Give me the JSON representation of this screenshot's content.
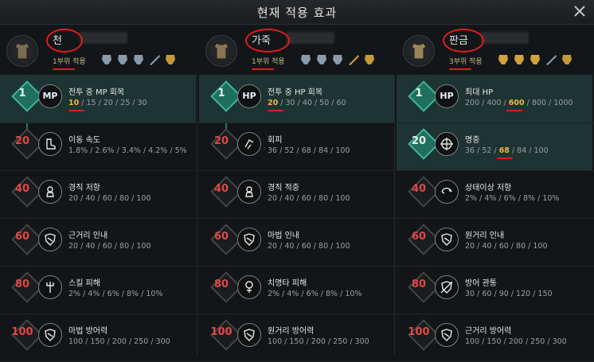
{
  "window": {
    "title": "현재 적용 효과"
  },
  "columns": [
    {
      "name": "천",
      "rank_label": "1부위 적용",
      "rows": [
        {
          "level": "1",
          "icon": "MP",
          "name": "전투 중 MP 회복",
          "values": [
            "10",
            "15",
            "20",
            "25",
            "30"
          ],
          "highlight": 0,
          "active": true
        },
        {
          "level": "20",
          "icon": "boot-icon",
          "name": "이동 속도",
          "values": [
            "1.8%",
            "2.6%",
            "3.4%",
            "4.2%",
            "5%"
          ],
          "highlight": -1,
          "active": false
        },
        {
          "level": "40",
          "icon": "stun-icon",
          "name": "경직 저항",
          "values": [
            "20",
            "40",
            "60",
            "80",
            "100"
          ],
          "highlight": -1,
          "active": false
        },
        {
          "level": "60",
          "icon": "shield-icon",
          "name": "근거리 인내",
          "values": [
            "20",
            "40",
            "60",
            "80",
            "100"
          ],
          "highlight": -1,
          "active": false
        },
        {
          "level": "80",
          "icon": "trident-icon",
          "name": "스킬 피해",
          "values": [
            "2%",
            "4%",
            "6%",
            "8%",
            "10%"
          ],
          "highlight": -1,
          "active": false
        },
        {
          "level": "100",
          "icon": "magic-shield-icon",
          "name": "마법 방어력",
          "values": [
            "100",
            "150",
            "200",
            "250",
            "300"
          ],
          "highlight": -1,
          "active": false
        }
      ]
    },
    {
      "name": "가죽",
      "rank_label": "1부위 적용",
      "rows": [
        {
          "level": "1",
          "icon": "HP",
          "name": "전투 중 HP 회복",
          "values": [
            "20",
            "30",
            "40",
            "50",
            "60"
          ],
          "highlight": 0,
          "active": true
        },
        {
          "level": "20",
          "icon": "dodge-icon",
          "name": "회피",
          "values": [
            "36",
            "52",
            "68",
            "84",
            "100"
          ],
          "highlight": -1,
          "active": false
        },
        {
          "level": "40",
          "icon": "stun-icon",
          "name": "경직 적중",
          "values": [
            "20",
            "40",
            "60",
            "80",
            "100"
          ],
          "highlight": -1,
          "active": false
        },
        {
          "level": "60",
          "icon": "shield-icon",
          "name": "마법 인내",
          "values": [
            "20",
            "40",
            "60",
            "80",
            "100"
          ],
          "highlight": -1,
          "active": false
        },
        {
          "level": "80",
          "icon": "crit-icon",
          "name": "치명타 피해",
          "values": [
            "2%",
            "4%",
            "6%",
            "8%",
            "10%"
          ],
          "highlight": -1,
          "active": false
        },
        {
          "level": "100",
          "icon": "ranged-shield-icon",
          "name": "원거리 방어력",
          "values": [
            "100",
            "150",
            "200",
            "250",
            "300"
          ],
          "highlight": -1,
          "active": false
        }
      ]
    },
    {
      "name": "판금",
      "rank_label": "3부위 적용",
      "rows": [
        {
          "level": "1",
          "icon": "HP",
          "name": "최대 HP",
          "values": [
            "200",
            "400",
            "600",
            "800",
            "1000"
          ],
          "highlight": 2,
          "active": true
        },
        {
          "level": "20",
          "icon": "crosshair-icon",
          "name": "명중",
          "values": [
            "36",
            "52",
            "68",
            "84",
            "100"
          ],
          "highlight": 2,
          "active": true
        },
        {
          "level": "40",
          "icon": "swirl-icon",
          "name": "상태이상 저항",
          "values": [
            "2%",
            "4%",
            "6%",
            "8%",
            "10%"
          ],
          "highlight": -1,
          "active": false
        },
        {
          "level": "60",
          "icon": "shield-icon",
          "name": "원거리 인내",
          "values": [
            "20",
            "40",
            "60",
            "80",
            "100"
          ],
          "highlight": -1,
          "active": false
        },
        {
          "level": "80",
          "icon": "pierce-icon",
          "name": "방어 관통",
          "values": [
            "30",
            "60",
            "90",
            "120",
            "150"
          ],
          "highlight": -1,
          "active": false
        },
        {
          "level": "100",
          "icon": "melee-shield-icon",
          "name": "근거리 방어력",
          "values": [
            "100",
            "150",
            "200",
            "250",
            "300"
          ],
          "highlight": -1,
          "active": false
        }
      ]
    }
  ],
  "colors": {
    "accent": "#3fb39a",
    "highlight": "#f0b44a",
    "level_red": "#e04848",
    "annotation": "#e01c1c"
  }
}
